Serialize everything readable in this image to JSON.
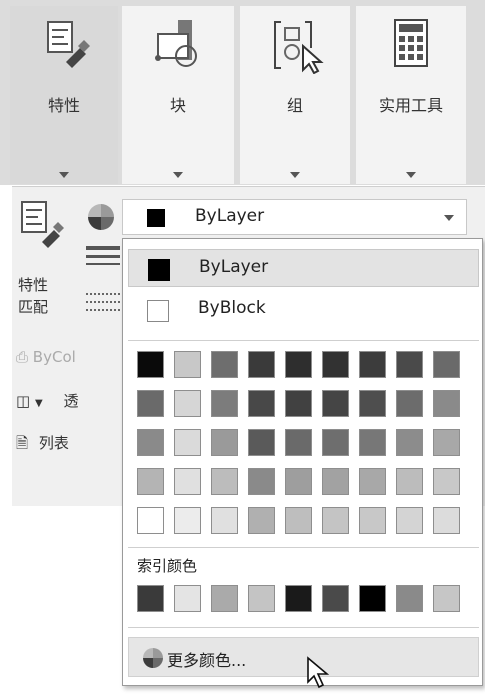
{
  "ribbon": {
    "panels": [
      {
        "label": "特性",
        "icon": "properties-icon"
      },
      {
        "label": "块",
        "icon": "block-icon"
      },
      {
        "label": "组",
        "icon": "group-icon"
      },
      {
        "label": "实用工具",
        "icon": "calculator-icon"
      }
    ]
  },
  "properties_panel": {
    "match_label_line1": "特性",
    "match_label_line2": "匹配",
    "plot_style_text": "ByCol",
    "transparency_text": "透",
    "list_label": "列表"
  },
  "color_combo": {
    "value": "ByLayer",
    "swatch_color": "#000000"
  },
  "color_dropdown": {
    "options": [
      {
        "label": "ByLayer",
        "swatch": "#000000",
        "selected": true
      },
      {
        "label": "ByBlock",
        "swatch": "#ffffff",
        "selected": false
      }
    ],
    "standard_grid": [
      [
        "#0a0a0a",
        "#c8c8c8",
        "#6e6e6e",
        "#3a3a3a",
        "#2e2e2e",
        "#323232",
        "#3c3c3c",
        "#4a4a4a",
        "#6a6a6a"
      ],
      [
        "#6a6a6a",
        "#d6d6d6",
        "#7c7c7c",
        "#484848",
        "#414141",
        "#454545",
        "#4e4e4e",
        "#6c6c6c",
        "#8a8a8a"
      ],
      [
        "#8a8a8a",
        "#dadada",
        "#9a9a9a",
        "#5a5a5a",
        "#6a6a6a",
        "#6e6e6e",
        "#777777",
        "#8c8c8c",
        "#a8a8a8"
      ],
      [
        "#b4b4b4",
        "#e0e0e0",
        "#bcbcbc",
        "#8a8a8a",
        "#9e9e9e",
        "#a2a2a2",
        "#a8a8a8",
        "#bcbcbc",
        "#c8c8c8"
      ],
      [
        "#ffffff",
        "#ececec",
        "#e0e0e0",
        "#b0b0b0",
        "#bebebe",
        "#c4c4c4",
        "#c8c8c8",
        "#d4d4d4",
        "#dcdcdc"
      ]
    ],
    "index_label": "索引颜色",
    "index_colors": [
      "#3a3a3a",
      "#e4e4e4",
      "#aaaaaa",
      "#c4c4c4",
      "#1a1a1a",
      "#4a4a4a",
      "#000000",
      "#8a8a8a",
      "#c6c6c6"
    ],
    "more_colors_label": "更多颜色..."
  }
}
